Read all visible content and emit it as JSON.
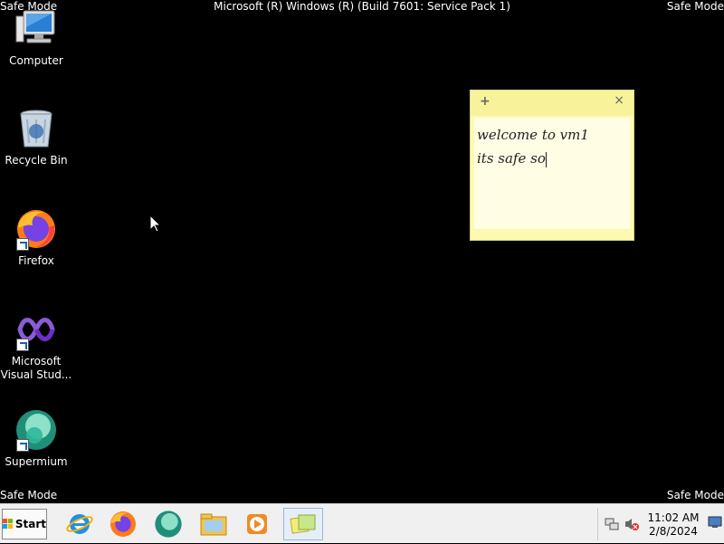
{
  "overlay": {
    "safe_mode": "Safe Mode",
    "title": "Microsoft (R) Windows (R) (Build 7601: Service Pack 1)"
  },
  "desktop": {
    "icons": [
      {
        "label": "Computer",
        "icon": "computer-icon"
      },
      {
        "label": "Recycle Bin",
        "icon": "recycle-bin-icon"
      },
      {
        "label": "Firefox",
        "icon": "firefox-icon"
      },
      {
        "label": "Microsoft\nVisual Stud...",
        "icon": "visual-studio-icon"
      },
      {
        "label": "Supermium",
        "icon": "supermium-icon"
      }
    ]
  },
  "note": {
    "lines": [
      "welcome to vm1",
      "its safe so"
    ],
    "add_glyph": "+",
    "close_glyph": "×"
  },
  "taskbar": {
    "start_label": "Start",
    "apps": [
      "internet-explorer-icon",
      "firefox-icon",
      "supermium-icon",
      "file-explorer-icon",
      "media-player-icon",
      "sticky-notes-icon"
    ],
    "clock_time": "11:02 AM",
    "clock_date": "2/8/2024"
  },
  "colors": {
    "desktop": "#000000",
    "note": "#fdf9b0",
    "taskbar": "#f0f0f0"
  }
}
